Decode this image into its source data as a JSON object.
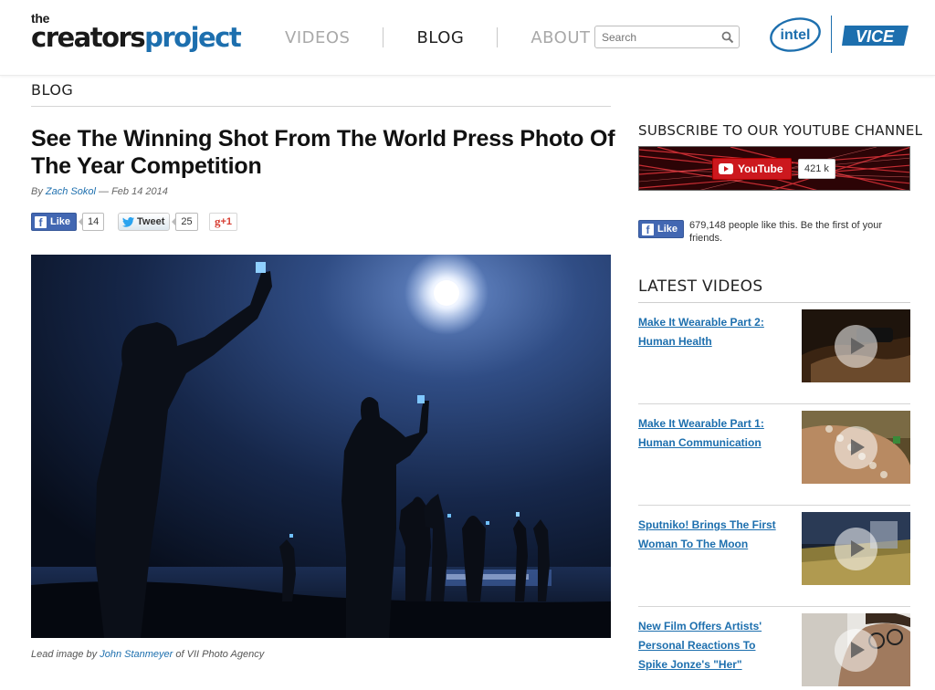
{
  "header": {
    "logo_small": "the",
    "logo_main_a": "creators",
    "logo_main_b": "project",
    "nav": [
      "VIDEOS",
      "BLOG",
      "ABOUT"
    ],
    "nav_active": "BLOG",
    "search_placeholder": "Search",
    "intel_logo": "intel",
    "vice_logo": "VICE"
  },
  "colors": {
    "accent": "#1d6fae",
    "facebook": "#4267b2",
    "youtube": "#cc181e",
    "google_plus": "#d73d32"
  },
  "section_label": "BLOG",
  "article": {
    "title": "See The Winning Shot From The World Press Photo Of The Year Competition",
    "by": "By",
    "author": "Zach Sokol",
    "date_sep": " — ",
    "date": "Feb 14 2014",
    "fb_like_label": "Like",
    "fb_like_count": "14",
    "tweet_label": "Tweet",
    "tweet_count": "25",
    "gplus_label": "+1",
    "caption_prefix": "Lead image by ",
    "caption_author": "John Stanmeyer",
    "caption_suffix": " of VII Photo Agency"
  },
  "sidebar": {
    "youtube_heading": "SUBSCRIBE TO OUR YOUTUBE CHANNEL",
    "youtube_label": "YouTube",
    "youtube_count": "421 k",
    "fb_like_label": "Like",
    "fb_text": "679,148 people like this. Be the first of your friends.",
    "latest_heading": "LATEST VIDEOS",
    "videos": [
      {
        "title": "Make It Wearable Part 2: Human Health",
        "thumb": "hand-watch"
      },
      {
        "title": "Make It Wearable Part 1: Human Communication",
        "thumb": "hand-keypad"
      },
      {
        "title": "Sputniko! Brings The First Woman To The Moon",
        "thumb": "field-night"
      },
      {
        "title": "New Film Offers Artists' Personal Reactions To Spike Jonze's \"Her\"",
        "thumb": "man-glasses"
      }
    ]
  }
}
